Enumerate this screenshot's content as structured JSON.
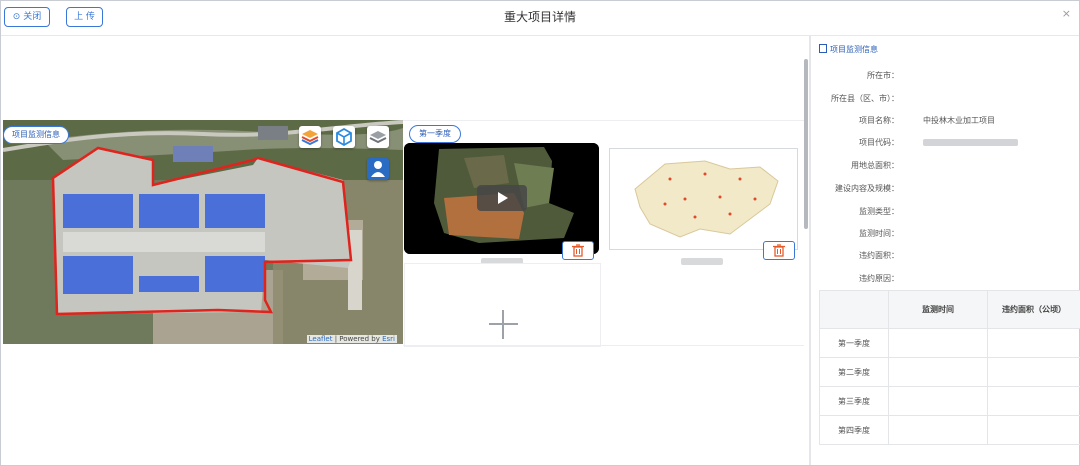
{
  "header": {
    "close_label": "⊙ 关闭",
    "upload_label": "上 传",
    "title": "重大项目详情",
    "close_glyph": "×"
  },
  "map": {
    "tag_label": "项目监测信息",
    "attribution_leaflet": "Leaflet",
    "attribution_sep": " | Powered by ",
    "attribution_esri": "Esri",
    "controls": [
      "layers-icon",
      "cube-icon",
      "stack-icon",
      "person-icon"
    ]
  },
  "media": {
    "season_tag": "第一季度",
    "video_icon": "play-icon",
    "delete_icon": "trash-icon",
    "add_icon": "plus-icon"
  },
  "info": {
    "heading": "项目监测信息",
    "rows": [
      {
        "label": "所在市：",
        "value": ""
      },
      {
        "label": "所在县（区、市）：",
        "value": ""
      },
      {
        "label": "项目名称：",
        "value": "中投林木业加工项目"
      },
      {
        "label": "项目代码：",
        "value": ""
      },
      {
        "label": "用地总面积：",
        "value": ""
      },
      {
        "label": "建设内容及规模：",
        "value": ""
      },
      {
        "label": "监测类型：",
        "value": ""
      },
      {
        "label": "监测时间：",
        "value": ""
      },
      {
        "label": "违约面积：",
        "value": ""
      },
      {
        "label": "违约原因：",
        "value": ""
      }
    ],
    "table": {
      "headers": [
        "",
        "监测时间",
        "违约面积（公顷）"
      ],
      "rows": [
        [
          "第一季度",
          "",
          ""
        ],
        [
          "第二季度",
          "",
          ""
        ],
        [
          "第三季度",
          "",
          ""
        ],
        [
          "第四季度",
          "",
          ""
        ]
      ]
    }
  },
  "colors": {
    "accent": "#3a78d8",
    "boundary": "#e0231c",
    "roof": "#4a6fd8"
  }
}
